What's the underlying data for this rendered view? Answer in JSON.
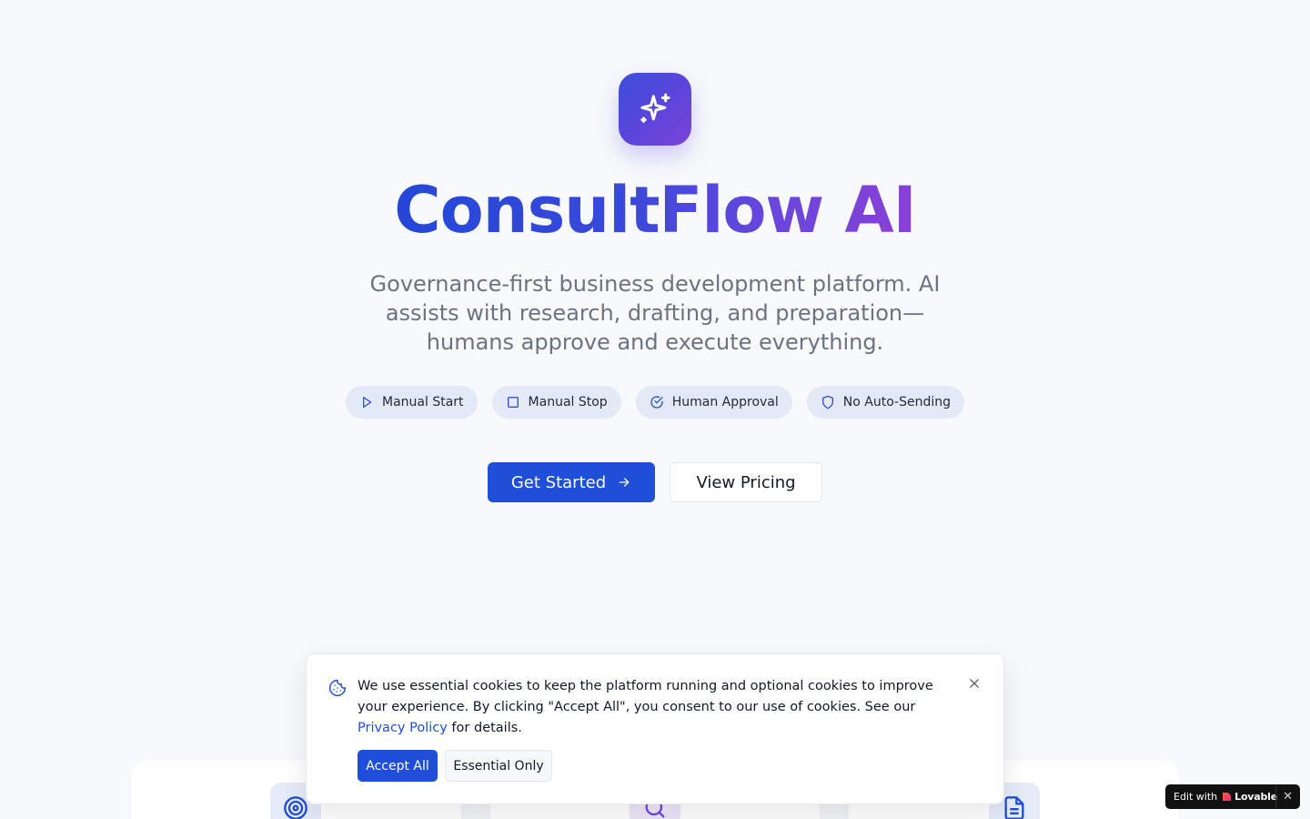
{
  "hero": {
    "title": "ConsultFlow AI",
    "subtitle": "Governance-first business development platform. AI assists with research, drafting, and preparation—humans approve and execute everything.",
    "logo_icon": "sparkles-icon"
  },
  "pills": [
    {
      "label": "Manual Start",
      "icon": "play-icon"
    },
    {
      "label": "Manual Stop",
      "icon": "square-icon"
    },
    {
      "label": "Human Approval",
      "icon": "circle-check-icon"
    },
    {
      "label": "No Auto-Sending",
      "icon": "shield-icon"
    }
  ],
  "cta": {
    "primary_label": "Get Started",
    "secondary_label": "View Pricing"
  },
  "features": {
    "icons": [
      "target-icon",
      "search-icon",
      "file-text-icon"
    ]
  },
  "cookie_banner": {
    "text_before_link": "We use essential cookies to keep the platform running and optional cookies to improve your experience. By clicking \"Accept All\", you consent to our use of cookies. See our ",
    "link_label": "Privacy Policy",
    "text_after_link": " for details.",
    "accept_label": "Accept All",
    "essential_label": "Essential Only"
  },
  "badge": {
    "prefix": "Edit with",
    "brand": "Lovable",
    "close": "✕"
  },
  "colors": {
    "primary": "#1f4ed8",
    "gradient_start": "#2347d8",
    "gradient_end": "#8a3fd6",
    "pill_bg": "#e4e9f6",
    "page_bg": "#f8f9fb"
  }
}
